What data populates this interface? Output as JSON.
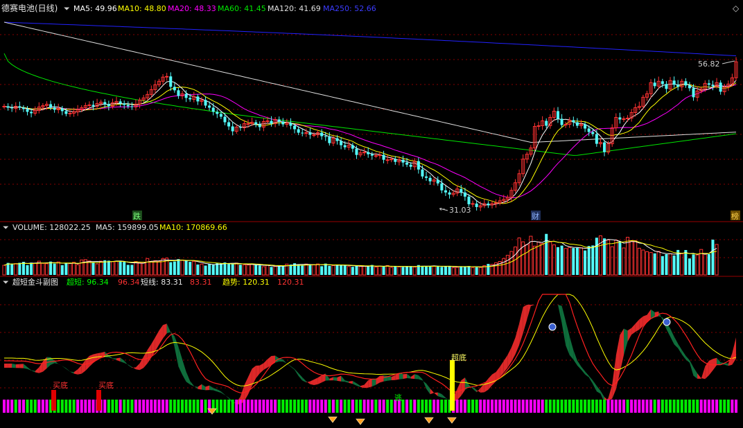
{
  "colors": {
    "background": "#000000",
    "up": "#ff3232",
    "down": "#54fcfc",
    "grid": "#8a0000",
    "border": "#9a0000",
    "ma5": "#ffffff",
    "ma10": "#ffff00",
    "ma20": "#ff00ff",
    "ma60": "#00e600",
    "ma120": "#e0e0e0",
    "ma250": "#2222ff",
    "fill_up": "#dc2828",
    "fill_down": "#0f6e3c",
    "bar_green": "#00ee00",
    "bar_magenta": "#ff00ff"
  },
  "main_panel": {
    "title": "德赛电池(日线)",
    "ma5_label": "MA5: 49.96",
    "ma10_label": "MA10: 48.80",
    "ma20_label": "MA20: 48.33",
    "ma60_label": "MA60: 41.45",
    "ma120_label": "MA120: 41.69",
    "ma250_label": "MA250: 52.66",
    "high_label": "56.82",
    "low_label": "31.03",
    "marker_1": "跌",
    "marker_2": "财",
    "marker_3": "榜"
  },
  "volume_panel": {
    "title": "VOLUME: 128022.25",
    "ma5_label": "MA5: 159899.05",
    "ma10_label": "MA10: 170869.66"
  },
  "indicator_panel": {
    "title": "超短金斗副图",
    "super_short_label": "超短: 96.34",
    "super_short_value2": "96.34",
    "short_label": "短线: 83.31",
    "short_value2": "83.31",
    "trend_label": "趋势: 120.31",
    "trend_value2": "120.31",
    "buy_label_1": "买底",
    "buy_label_2": "买底",
    "super_bottom_label": "超底",
    "escape_label": "逃"
  },
  "chart_data": [
    {
      "type": "candlestick",
      "title": "德赛电池(日线)",
      "ylim": [
        29,
        58.5
      ],
      "x": [
        1,
        2,
        3,
        4,
        5,
        6,
        7,
        8,
        9,
        10,
        11,
        12,
        13,
        14,
        15,
        16,
        17,
        18,
        19,
        20,
        21,
        22,
        23,
        24,
        25,
        26,
        27,
        28,
        29,
        30,
        31,
        32,
        33,
        34,
        35,
        36,
        37,
        38,
        39,
        40,
        41,
        42,
        43,
        44,
        45,
        46,
        47,
        48,
        49,
        50,
        51,
        52,
        53,
        54,
        55,
        56,
        57,
        58,
        59,
        60,
        61,
        62,
        63,
        64,
        65,
        66,
        67,
        68,
        69,
        70,
        71,
        72,
        73,
        74,
        75,
        76,
        77,
        78,
        79,
        80,
        81,
        82,
        83,
        84,
        85,
        86,
        87,
        88,
        89,
        90,
        91,
        92,
        93,
        94,
        95,
        96,
        97,
        98,
        99,
        100,
        101,
        102,
        103,
        104,
        105,
        106,
        107,
        108,
        109,
        110,
        111,
        112,
        113,
        114,
        115,
        116,
        117,
        118,
        119,
        120,
        121,
        122,
        123,
        124,
        125,
        126,
        127,
        128,
        129,
        130,
        131,
        132,
        133,
        134,
        135,
        136,
        137,
        138,
        139,
        140,
        141,
        142,
        143,
        144,
        145,
        146,
        147,
        148,
        149,
        150,
        151,
        152,
        153,
        154,
        155,
        156,
        157,
        158,
        159,
        160,
        161,
        162,
        163,
        164,
        165,
        166,
        167,
        168,
        169,
        170,
        171,
        172,
        173,
        174,
        175,
        176,
        177,
        178,
        179,
        180,
        181,
        182,
        183,
        184,
        185,
        186,
        187,
        188,
        189,
        190
      ],
      "close": [
        45.4,
        45.2,
        45.1,
        45.4,
        45.2,
        45.0,
        44.6,
        44.4,
        44.8,
        45.3,
        45.5,
        45.7,
        45.2,
        44.9,
        45.1,
        44.7,
        44.3,
        44.4,
        44.6,
        44.9,
        45.2,
        45.5,
        45.6,
        45.4,
        45.8,
        46.0,
        45.7,
        45.4,
        45.9,
        46.1,
        45.8,
        45.6,
        45.4,
        45.3,
        45.7,
        46.3,
        46.6,
        47.1,
        47.8,
        48.5,
        49.0,
        49.6,
        49.7,
        48.2,
        47.7,
        46.9,
        47.2,
        46.6,
        46.4,
        46.8,
        46.1,
        46.3,
        45.5,
        45.2,
        44.6,
        44.3,
        43.9,
        43.1,
        42.5,
        41.8,
        42.4,
        42.3,
        42.9,
        42.9,
        43.1,
        42.8,
        42.4,
        43.2,
        43.3,
        42.9,
        43.5,
        43.2,
        42.8,
        43.0,
        42.6,
        42.1,
        41.6,
        41.5,
        41.6,
        41.3,
        41.3,
        41.6,
        41.1,
        41.0,
        40.1,
        40.8,
        40.4,
        39.8,
        39.5,
        39.8,
        39.3,
        38.4,
        38.7,
        38.8,
        38.5,
        38.3,
        38.3,
        38.4,
        37.7,
        37.7,
        37.8,
        37.4,
        37.7,
        37.3,
        37.0,
        36.7,
        37.5,
        36.3,
        35.3,
        35.1,
        34.6,
        34.8,
        34.3,
        33.3,
        33.0,
        32.7,
        32.9,
        33.5,
        33.0,
        32.4,
        31.3,
        31.4,
        30.9,
        31.1,
        31.4,
        31.2,
        31.4,
        31.5,
        31.8,
        32.0,
        32.3,
        33.3,
        34.4,
        35.7,
        37.8,
        38.5,
        39.4,
        42.5,
        42.6,
        43.3,
        42.6,
        43.8,
        44.7,
        43.6,
        42.7,
        42.8,
        43.4,
        43.1,
        42.6,
        42.8,
        42.2,
        41.7,
        41.4,
        40.0,
        40.2,
        38.8,
        40.0,
        42.3,
        43.8,
        43.5,
        43.6,
        43.7,
        44.5,
        45.2,
        45.4,
        46.7,
        47.2,
        48.8,
        48.3,
        49.0,
        48.6,
        47.9,
        49.1,
        48.5,
        48.2,
        49.0,
        48.4,
        48.0,
        46.7,
        47.6,
        47.9,
        48.7,
        48.5,
        48.3,
        48.8,
        47.5,
        48.2,
        48.6,
        49.5,
        51.8
      ]
    },
    {
      "type": "bar",
      "title": "VOLUME: 128022.25",
      "series": [
        {
          "name": "VOLUME",
          "values": [
            28650,
            35650,
            33200,
            33700,
            35900,
            38700,
            29000,
            36450,
            35000,
            40750,
            34300,
            33150,
            39550,
            33650,
            38800,
            29000,
            33900,
            34500,
            37550,
            30450,
            44400,
            45350,
            41300,
            35700,
            32600,
            40800,
            43500,
            42200,
            39300,
            39850,
            41150,
            38550,
            29800,
            30000,
            39800,
            36150,
            37800,
            48600,
            39750,
            42350,
            40300,
            48450,
            49850,
            37750,
            39800,
            46750,
            44300,
            42350,
            38700,
            40200,
            30850,
            32200,
            27700,
            32150,
            29800,
            34450,
            34550,
            37100,
            34600,
            32200,
            35200,
            30150,
            29900,
            29550,
            31300,
            29750,
            28200,
            24500,
            28900,
            23750,
            25050,
            26950,
            26800,
            32100,
            30700,
            34500,
            30150,
            28750,
            32300,
            29300,
            30850,
            32500,
            25900,
            33600,
            26950,
            27800,
            30600,
            28000,
            29700,
            25050,
            24050,
            27750,
            25100,
            25950,
            24800,
            29500,
            23400,
            26000,
            25350,
            27900,
            22200,
            26800,
            24050,
            23600,
            26250,
            25800,
            23450,
            29300,
            26500,
            25800,
            25650,
            26550,
            25200,
            23800,
            25300,
            26800,
            21200,
            22700,
            25850,
            25700,
            26400,
            21850,
            22800,
            22050,
            27550,
            32800,
            31300,
            36150,
            39950,
            48600,
            58200,
            69600,
            82800,
            109550,
            98150,
            89950,
            114600,
            85300,
            97700,
            93000,
            121450,
            98000,
            89100,
            82200,
            86850,
            78350,
            81300,
            79650,
            80200,
            80600,
            72450,
            85600,
            87300,
            110250,
            115800,
            108200,
            103400,
            83650,
            103150,
            99700,
            80000,
            111500,
            100250,
            101100,
            79150,
            73800,
            68850,
            66450,
            63900,
            69700,
            55650,
            61400,
            62750,
            57550,
            73950,
            63000,
            73700,
            48800,
            60800,
            59300,
            75450,
            61950,
            61650,
            104450,
            90350
          ]
        }
      ],
      "ylim": [
        0,
        125000
      ]
    },
    {
      "type": "line",
      "title": "超短金斗副图",
      "series": [
        {
          "name": "超短"
        },
        {
          "name": "短线"
        },
        {
          "name": "趋势"
        }
      ],
      "last_values": {
        "超短": 96.34,
        "短线": 83.31,
        "趋势": 120.31
      }
    }
  ]
}
